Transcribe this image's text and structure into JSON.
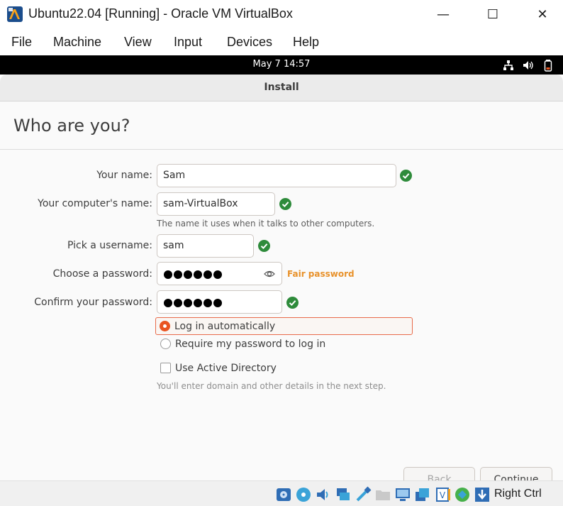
{
  "window": {
    "title": "Ubuntu22.04 [Running] - Oracle VM VirtualBox",
    "minimize_glyph": "—",
    "maximize_glyph": "☐",
    "close_glyph": "✕"
  },
  "menu": [
    "File",
    "Machine",
    "View",
    "Input",
    "Devices",
    "Help"
  ],
  "guest_topbar": {
    "clock": "May 7  14:57",
    "tray_icons": [
      "network-icon",
      "volume-icon",
      "battery-icon"
    ]
  },
  "installer": {
    "title": "Install",
    "heading": "Who are you?",
    "fields": {
      "your_name": {
        "label": "Your name:",
        "value": "Sam",
        "valid": true
      },
      "computer_name": {
        "label": "Your computer's name:",
        "value": "sam-VirtualBox",
        "hint": "The name it uses when it talks to other computers.",
        "valid": true
      },
      "username": {
        "label": "Pick a username:",
        "value": "sam",
        "valid": true
      },
      "password": {
        "label": "Choose a password:",
        "masked_length": 6,
        "strength": "Fair password"
      },
      "confirm_password": {
        "label": "Confirm your password:",
        "masked_length": 6,
        "valid": true
      }
    },
    "login_options": [
      {
        "label": "Log in automatically",
        "selected": true
      },
      {
        "label": "Require my password to log in",
        "selected": false
      }
    ],
    "active_directory": {
      "label": "Use Active Directory",
      "checked": false,
      "hint": "You'll enter domain and other details in the next step."
    },
    "buttons": {
      "back": "Back",
      "continue": "Continue"
    },
    "colors": {
      "accent": "#e95420",
      "valid": "#2e8b3b",
      "strength_fair": "#e8912a"
    }
  },
  "statusbar": {
    "icons": [
      "hard-disk-icon",
      "optical-drive-icon",
      "audio-icon",
      "network-adapter-icon",
      "usb-icon",
      "shared-folder-icon",
      "display-icon",
      "recording-icon",
      "virtualization-icon",
      "mouse-integration-icon",
      "keyboard-capture-icon"
    ],
    "host_key": "Right Ctrl"
  }
}
